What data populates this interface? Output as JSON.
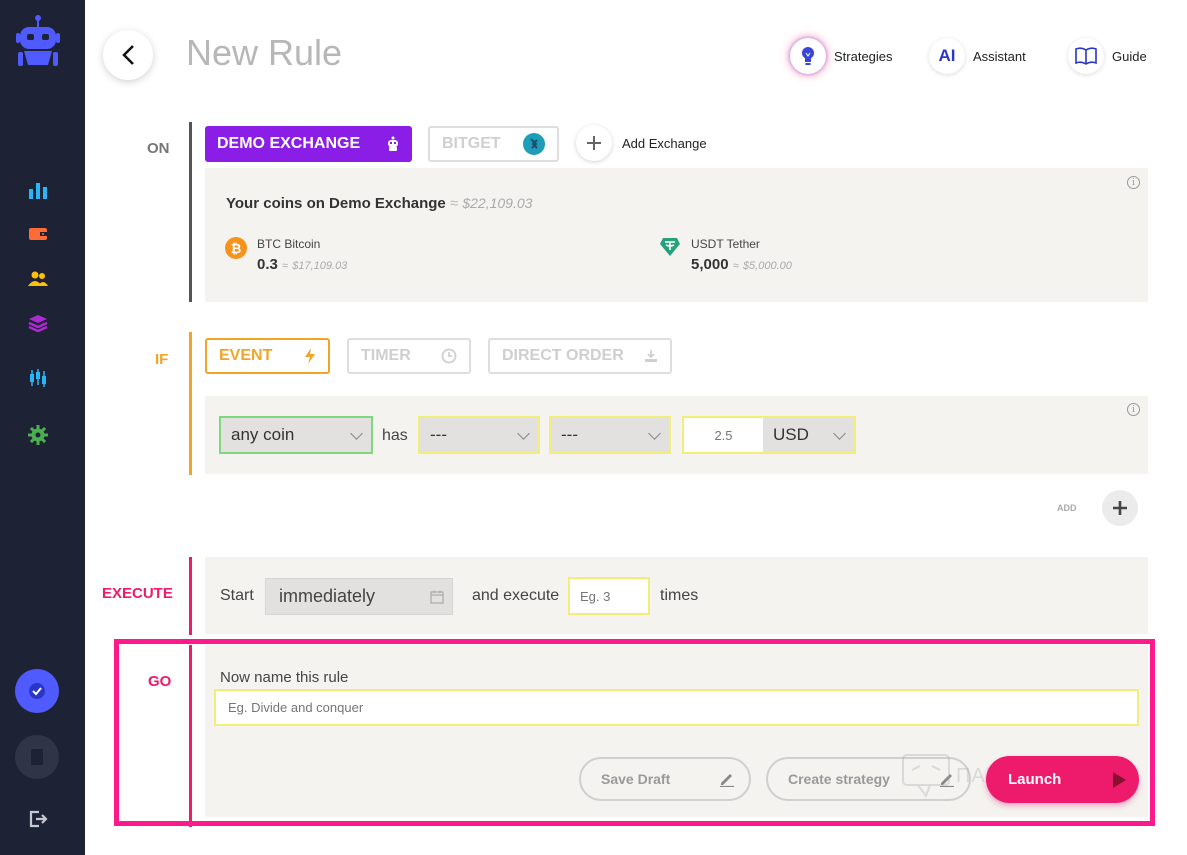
{
  "header": {
    "title": "New Rule",
    "strategies": "Strategies",
    "assistant": "Assistant",
    "assistant_icon": "AI",
    "guide": "Guide"
  },
  "on": {
    "label": "ON",
    "exchange_active": "DEMO EXCHANGE",
    "exchange_other": "BITGET",
    "add_exchange": "Add Exchange",
    "coins_title": "Your coins on Demo Exchange",
    "coins_total": "$22,109.03",
    "approx": "≈",
    "coins": [
      {
        "name": "BTC Bitcoin",
        "amount": "0.3",
        "usd": "$17,109.03"
      },
      {
        "name": "USDT Tether",
        "amount": "5,000",
        "usd": "$5,000.00"
      }
    ]
  },
  "if": {
    "label": "IF",
    "tabs": [
      "EVENT",
      "TIMER",
      "DIRECT ORDER"
    ],
    "coin_select": "any coin",
    "has": "has",
    "select2": "---",
    "select3": "---",
    "amount_placeholder": "2.5",
    "currency": "USD",
    "add": "ADD"
  },
  "execute": {
    "label": "EXECUTE",
    "start": "Start",
    "start_value": "immediately",
    "and_execute": "and execute",
    "times_placeholder": "Eg. 3",
    "times": "times"
  },
  "go": {
    "label": "GO",
    "name_label": "Now name this rule",
    "name_placeholder": "Eg. Divide and conquer",
    "save_draft": "Save Draft",
    "create_strategy": "Create strategy",
    "launch": "Launch",
    "watermark": "ПАРТНЕРКИН"
  },
  "colors": {
    "sidebar": "#1e2235",
    "purple": "#8a1ee6",
    "orange": "#f0a52a",
    "pink": "#ee1a6b",
    "highlight": "#ff1a8c"
  }
}
